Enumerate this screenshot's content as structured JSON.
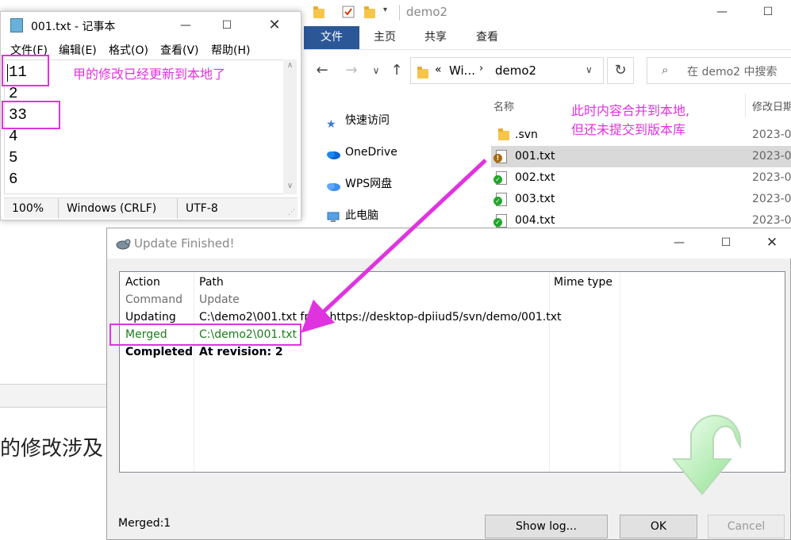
{
  "background": {
    "text": "的修改涉及"
  },
  "explorer": {
    "title": "demo2",
    "ribbon_tabs": [
      "文件",
      "主页",
      "共享",
      "查看"
    ],
    "breadcrumb_prefix": "«",
    "breadcrumb_parent": "Wi...",
    "breadcrumb_current": "demo2",
    "search_placeholder": "在 demo2 中搜索",
    "nav_items": [
      "快速访问",
      "OneDrive",
      "WPS网盘",
      "此电脑"
    ],
    "columns": {
      "name": "名称",
      "date": "修改日期"
    },
    "files": [
      {
        "name": ".svn",
        "date": "2023-0",
        "type": "folder",
        "status": ""
      },
      {
        "name": "001.txt",
        "date": "2023-0",
        "type": "file",
        "status": "modified"
      },
      {
        "name": "002.txt",
        "date": "2023-0",
        "type": "file",
        "status": "ok"
      },
      {
        "name": "003.txt",
        "date": "2023-0",
        "type": "file",
        "status": "ok"
      },
      {
        "name": "004.txt",
        "date": "2023-0",
        "type": "file",
        "status": "ok"
      }
    ],
    "note_line1": "此时内容合并到本地,",
    "note_line2": "但还未提交到版本库"
  },
  "notepad": {
    "title": "001.txt - 记事本",
    "menus": [
      "文件(F)",
      "编辑(E)",
      "格式(O)",
      "查看(V)",
      "帮助(H)"
    ],
    "lines": [
      "11",
      "2",
      "33",
      "4",
      "5",
      "6"
    ],
    "status": {
      "zoom": "100%",
      "line_ending": "Windows (CRLF)",
      "encoding": "UTF-8"
    },
    "note": "甲的修改已经更新到本地了"
  },
  "dialog": {
    "title": "Update Finished!",
    "columns": {
      "action": "Action",
      "path": "Path",
      "mime": "Mime type"
    },
    "rows": [
      {
        "action": "Command",
        "path": "Update",
        "style": "gray"
      },
      {
        "action": "Updating",
        "path": "C:\\demo2\\001.txt from https://desktop-dpiiud5/svn/demo/001.txt",
        "style": "normal"
      },
      {
        "action": "Merged",
        "path": "C:\\demo2\\001.txt",
        "style": "green"
      },
      {
        "action": "Completed",
        "path": "At revision: 2",
        "style": "bold"
      }
    ],
    "summary": "Merged:1",
    "buttons": {
      "show_log": "Show log...",
      "ok": "OK",
      "cancel": "Cancel"
    }
  },
  "colors": {
    "annotation": "#e033e0",
    "merged_text": "#1b7d1b",
    "ribbon_file": "#2b5797"
  }
}
